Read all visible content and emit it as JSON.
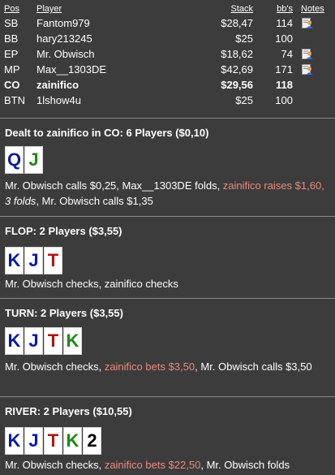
{
  "table": {
    "headers": {
      "pos": "Pos",
      "player": "Player",
      "stack": "Stack",
      "bbs": "bb's",
      "notes": "Notes"
    },
    "rows": [
      {
        "pos": "SB",
        "player": "Fantom979",
        "stack": "$28,47",
        "bbs": "114",
        "note": true
      },
      {
        "pos": "BB",
        "player": "hary213245",
        "stack": "$25",
        "bbs": "100",
        "note": false
      },
      {
        "pos": "EP",
        "player": "Mr. Obwisch",
        "stack": "$18,62",
        "bbs": "74",
        "note": true
      },
      {
        "pos": "MP",
        "player": "Max__1303DE",
        "stack": "$42,69",
        "bbs": "171",
        "note": true
      },
      {
        "pos": "CO",
        "player": "zainifico",
        "stack": "$29,56",
        "bbs": "118",
        "note": false,
        "hero": true
      },
      {
        "pos": "BTN",
        "player": "1lshow4u",
        "stack": "$25",
        "bbs": "100",
        "note": false
      }
    ]
  },
  "preflop": {
    "title": "Dealt to zainifico in CO: 6 Players ($0,10)",
    "cards": [
      {
        "rank": "Q",
        "suit": "blue"
      },
      {
        "rank": "J",
        "suit": "green"
      }
    ],
    "a1": "Mr. Obwisch calls $0,25, Max__1303DE folds, ",
    "a2": "zainifico raises $1,60, ",
    "a3": "3 folds",
    "a4": ", Mr. Obwisch calls $1,35"
  },
  "flop": {
    "title": "FLOP: 2 Players ($3,55)",
    "cards": [
      {
        "rank": "K",
        "suit": "blue"
      },
      {
        "rank": "J",
        "suit": "blue"
      },
      {
        "rank": "T",
        "suit": "red"
      }
    ],
    "action": "Mr. Obwisch checks, zainifico checks"
  },
  "turn": {
    "title": "TURN: 2 Players ($3,55)",
    "cards": [
      {
        "rank": "K",
        "suit": "blue"
      },
      {
        "rank": "J",
        "suit": "blue"
      },
      {
        "rank": "T",
        "suit": "red"
      },
      {
        "rank": "K",
        "suit": "green"
      }
    ],
    "a1": "Mr. Obwisch checks, ",
    "a2": "zainifico bets $3,50",
    "a3": ", Mr. Obwisch calls $3,50"
  },
  "river": {
    "title": "RIVER: 2 Players ($10,55)",
    "cards": [
      {
        "rank": "K",
        "suit": "blue"
      },
      {
        "rank": "J",
        "suit": "blue"
      },
      {
        "rank": "T",
        "suit": "red"
      },
      {
        "rank": "K",
        "suit": "green"
      },
      {
        "rank": "2",
        "suit": "black"
      }
    ],
    "a1": "Mr. Obwisch checks, ",
    "a2": "zainifico bets $22,50",
    "a3": ", Mr. Obwisch folds"
  },
  "colors": {
    "background": "#3c3c3c",
    "highlight": "#e98b78",
    "blue_suit": "#0a1aa6",
    "green_suit": "#1e8a16",
    "red_suit": "#b01515"
  },
  "icons": {
    "note": "note-icon"
  }
}
